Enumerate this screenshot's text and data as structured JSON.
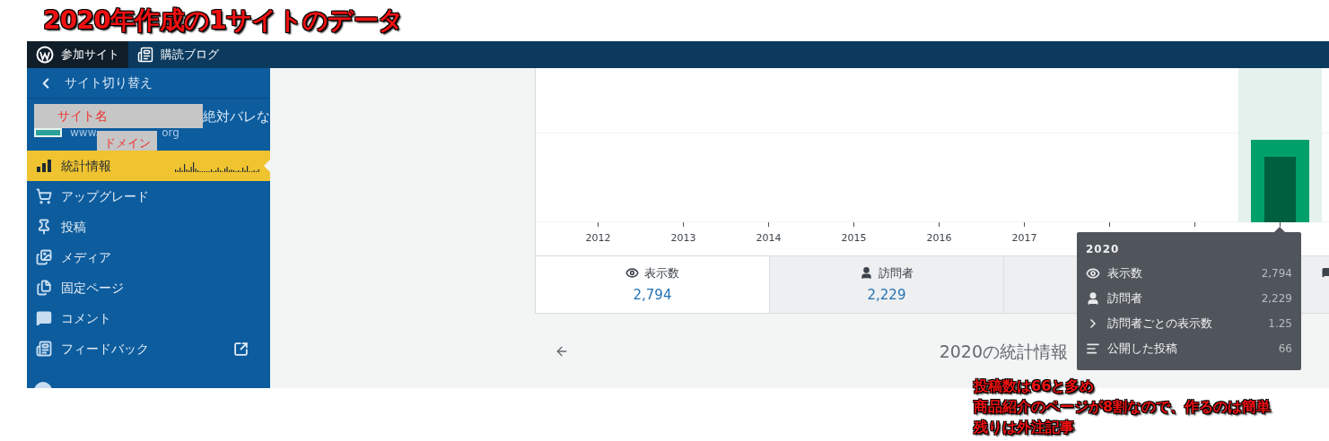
{
  "annotation_title": "2020年作成の1サイトのデータ",
  "top_bar": {
    "items": [
      {
        "kind": "sites",
        "label": "参加サイト",
        "selected": true
      },
      {
        "kind": "reader",
        "label": "購読ブログ",
        "selected": false
      }
    ]
  },
  "sidebar": {
    "switch_site": "サイト切り替え",
    "site": {
      "name": "絶対バレな",
      "domain_start": "www.",
      "domain_end": "org"
    },
    "redaction_labels": [
      "サイト名",
      "ドメイン"
    ],
    "items": [
      {
        "kind": "stats",
        "label": "統計情報",
        "selected": true,
        "external": false
      },
      {
        "kind": "upgrade",
        "label": "アップグレード",
        "selected": false,
        "external": false
      },
      {
        "kind": "posts",
        "label": "投稿",
        "selected": false,
        "external": false
      },
      {
        "kind": "media",
        "label": "メディア",
        "selected": false,
        "external": false
      },
      {
        "kind": "pages",
        "label": "固定ページ",
        "selected": false,
        "external": false
      },
      {
        "kind": "comments",
        "label": "コメント",
        "selected": false,
        "external": false
      },
      {
        "kind": "feedback",
        "label": "フィードバック",
        "selected": false,
        "external": true
      }
    ]
  },
  "chart": {
    "x_axis_labels": [
      "2012",
      "2013",
      "2014",
      "2015",
      "2016",
      "2017"
    ]
  },
  "stat_tabs": [
    {
      "kind": "views",
      "label": "表示数",
      "value": "2,794",
      "selected": true
    },
    {
      "kind": "visitors",
      "label": "訪問者",
      "value": "2,229",
      "selected": false
    }
  ],
  "tooltip": {
    "title": "2020",
    "rows": [
      {
        "kind": "views",
        "label": "表示数",
        "value": "2,794"
      },
      {
        "kind": "visitors",
        "label": "訪問者",
        "value": "2,229"
      },
      {
        "kind": "ratio",
        "label": "訪問者ごとの表示数",
        "value": "1.25"
      },
      {
        "kind": "posts",
        "label": "公開した投稿",
        "value": "66"
      }
    ]
  },
  "period_title": "2020の統計情報",
  "annotation_note": [
    "投稿数は66と多め",
    "商品紹介のページが8割なので、作るのは簡単",
    "残りは外注記事"
  ]
}
